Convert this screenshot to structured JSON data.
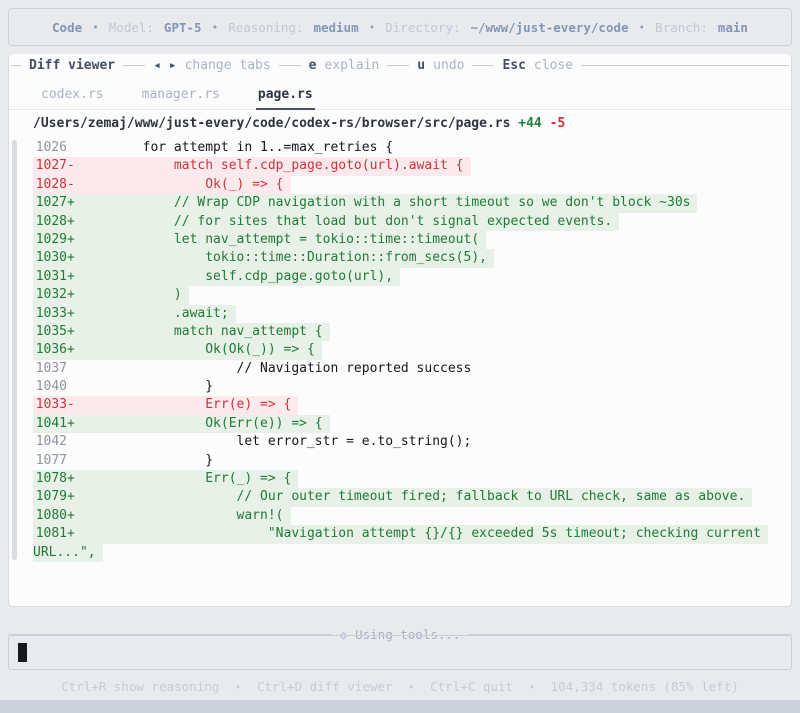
{
  "topbar": {
    "brand": "Code",
    "separator": "•",
    "items": [
      {
        "label": "Model:",
        "value": "GPT-5"
      },
      {
        "label": "Reasoning:",
        "value": "medium"
      },
      {
        "label": "Directory:",
        "value": "~/www/just-every/code"
      },
      {
        "label": "Branch:",
        "value": "main"
      }
    ]
  },
  "diff_viewer": {
    "title": "Diff viewer",
    "shortcuts": [
      {
        "key": "◂ ▸",
        "label": "change tabs"
      },
      {
        "key": "e",
        "label": "explain"
      },
      {
        "key": "u",
        "label": "undo"
      },
      {
        "key": "Esc",
        "label": "close"
      }
    ],
    "tabs": [
      {
        "label": "codex.rs",
        "active": false
      },
      {
        "label": "manager.rs",
        "active": false
      },
      {
        "label": "page.rs",
        "active": true
      }
    ],
    "file_path": "/Users/zemaj/www/just-every/code/codex-rs/browser/src/page.rs",
    "additions": "+44",
    "deletions": "-5",
    "lines": [
      {
        "num": "1026",
        "sign": "",
        "type": "ctx",
        "text": "        for attempt in 1..=max_retries {"
      },
      {
        "num": "1027",
        "sign": "-",
        "type": "del",
        "text": "            match self.cdp_page.goto(url).await {"
      },
      {
        "num": "1028",
        "sign": "-",
        "type": "del",
        "text": "                Ok(_) => {"
      },
      {
        "num": "1027",
        "sign": "+",
        "type": "add",
        "text": "            // Wrap CDP navigation with a short timeout so we don't block ~30s"
      },
      {
        "num": "1028",
        "sign": "+",
        "type": "add",
        "text": "            // for sites that load but don't signal expected events."
      },
      {
        "num": "1029",
        "sign": "+",
        "type": "add",
        "text": "            let nav_attempt = tokio::time::timeout("
      },
      {
        "num": "1030",
        "sign": "+",
        "type": "add",
        "text": "                tokio::time::Duration::from_secs(5),"
      },
      {
        "num": "1031",
        "sign": "+",
        "type": "add",
        "text": "                self.cdp_page.goto(url),"
      },
      {
        "num": "1032",
        "sign": "+",
        "type": "add",
        "text": "            )"
      },
      {
        "num": "1033",
        "sign": "+",
        "type": "add",
        "text": "            .await;"
      },
      {
        "num": "1035",
        "sign": "+",
        "type": "add",
        "text": "            match nav_attempt {"
      },
      {
        "num": "1036",
        "sign": "+",
        "type": "add",
        "text": "                Ok(Ok(_)) => {"
      },
      {
        "num": "1037",
        "sign": "",
        "type": "ctx",
        "text": "                    // Navigation reported success"
      },
      {
        "num": "1040",
        "sign": "",
        "type": "ctx",
        "text": "                }"
      },
      {
        "num": "1033",
        "sign": "-",
        "type": "del",
        "text": "                Err(e) => {"
      },
      {
        "num": "1041",
        "sign": "+",
        "type": "add",
        "text": "                Ok(Err(e)) => {"
      },
      {
        "num": "1042",
        "sign": "",
        "type": "ctx",
        "text": "                    let error_str = e.to_string();"
      },
      {
        "num": "1077",
        "sign": "",
        "type": "ctx",
        "text": "                }"
      },
      {
        "num": "1078",
        "sign": "+",
        "type": "add",
        "text": "                Err(_) => {"
      },
      {
        "num": "1079",
        "sign": "+",
        "type": "add",
        "text": "                    // Our outer timeout fired; fallback to URL check, same as above."
      },
      {
        "num": "1080",
        "sign": "+",
        "type": "add",
        "text": "                    warn!("
      },
      {
        "num": "1081",
        "sign": "+",
        "type": "add",
        "text": "                        \"Navigation attempt {}/{} exceeded 5s timeout; checking current"
      },
      {
        "num": "",
        "sign": "",
        "type": "add-wrap",
        "text": "URL...\","
      }
    ]
  },
  "tools_divider": {
    "icon": "◇",
    "label": "Using tools..."
  },
  "composer": {
    "value": "",
    "cursor_visible": true
  },
  "footer": {
    "separator": "•",
    "items": [
      {
        "key": "Ctrl+R",
        "label": "show reasoning"
      },
      {
        "key": "Ctrl+D",
        "label": "diff viewer"
      },
      {
        "key": "Ctrl+C",
        "label": "quit"
      }
    ],
    "tokens": "104,334 tokens (85% left)"
  },
  "colors": {
    "addition_text": "#217a37",
    "addition_bg": "#e7f1e8",
    "deletion_text": "#cc3340",
    "deletion_bg": "#fbe9eb",
    "accent_muted_blue": "#8296b8",
    "page_bg": "#e8eaee"
  }
}
